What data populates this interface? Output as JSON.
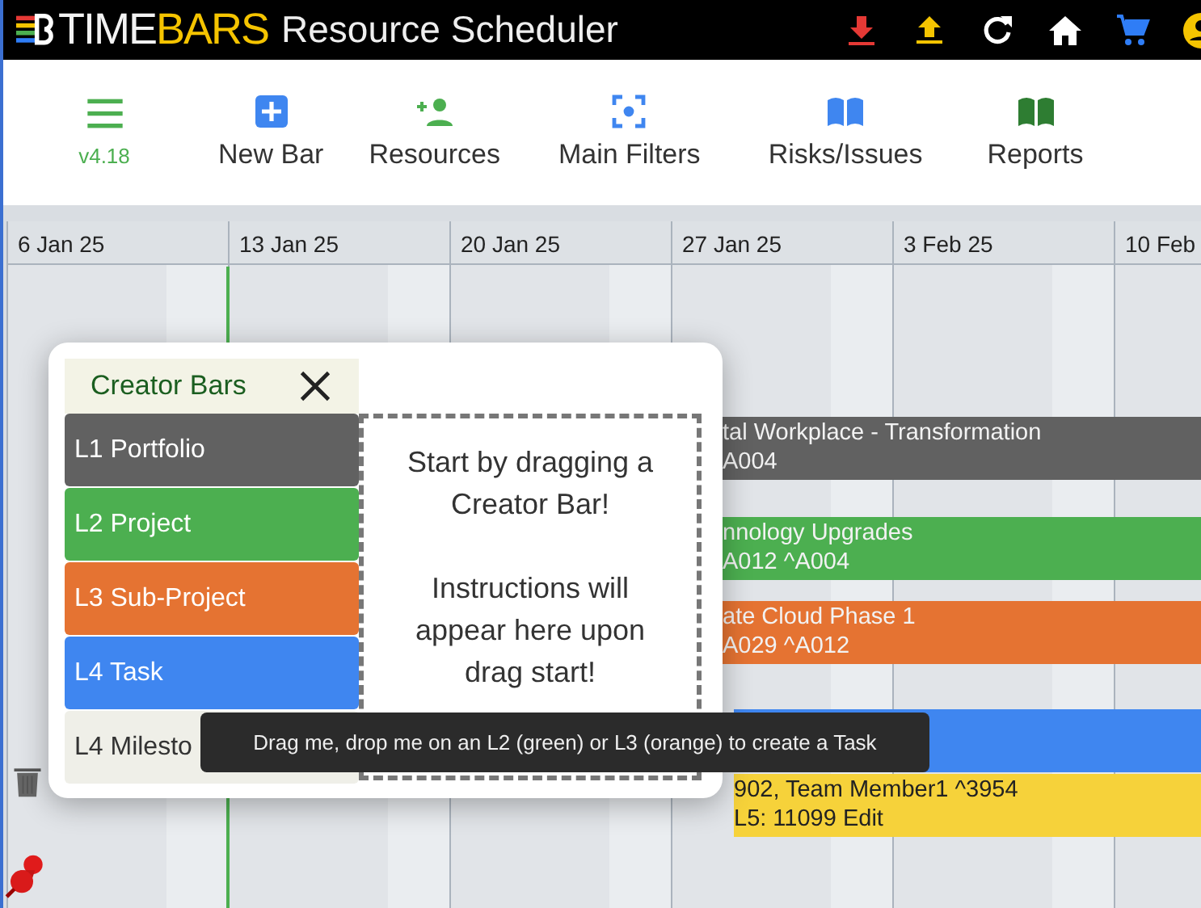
{
  "header": {
    "logo": {
      "part_1": "TIME",
      "part_2": "BARS"
    },
    "title": "Resource Scheduler",
    "icons": [
      {
        "kind": "download",
        "color": "#e53935"
      },
      {
        "kind": "upload",
        "color": "#f5c400"
      },
      {
        "kind": "refresh",
        "color": "#ffffff"
      },
      {
        "kind": "home",
        "color": "#ffffff"
      },
      {
        "kind": "cart",
        "color": "#2f7df6"
      },
      {
        "kind": "user",
        "color": "#f5c400"
      }
    ]
  },
  "toolbar": {
    "version": "v4.18",
    "buttons": [
      {
        "label": "New Bar",
        "kind": "new"
      },
      {
        "label": "Resources",
        "kind": "resources"
      },
      {
        "label": "Main Filters",
        "kind": "filters"
      },
      {
        "label": "Risks/Issues",
        "kind": "risks"
      },
      {
        "label": "Reports",
        "kind": "reports"
      }
    ]
  },
  "timeline": {
    "weeks": [
      "6 Jan 25",
      "13 Jan 25",
      "20 Jan 25",
      "27 Jan 25",
      "3 Feb 25",
      "10 Feb"
    ]
  },
  "bars": [
    {
      "lines": [
        "tal Workplace - Transformation",
        "A004"
      ],
      "color": "#616161"
    },
    {
      "lines": [
        "nnology Upgrades",
        "A012 ^A004"
      ],
      "color": "#4caf50"
    },
    {
      "lines": [
        "ate Cloud Phase 1",
        "A029 ^A012"
      ],
      "color": "#e57332"
    },
    {
      "color": "#3f86f0"
    },
    {
      "lines": [
        "902, Team Member1 ^3954",
        "L5: 11099   Edit"
      ],
      "color": "#f6d23a"
    }
  ],
  "creator_panel": {
    "title": "Creator Bars",
    "items": [
      {
        "label": "L1 Portfolio",
        "color": "#616161"
      },
      {
        "label": "L2 Project",
        "color": "#4caf50"
      },
      {
        "label": "L3 Sub-Project",
        "color": "#e57332"
      },
      {
        "label": "L4 Task",
        "color": "#3f86f0"
      },
      {
        "label": "L4 Milesto",
        "color": "#efefe8"
      }
    ],
    "drop_text": [
      "Start by dragging a Creator Bar!",
      "Instructions will appear here upon drag start!"
    ]
  },
  "tooltip": "Drag me, drop me on an L2 (green) or L3 (orange) to create a Task"
}
